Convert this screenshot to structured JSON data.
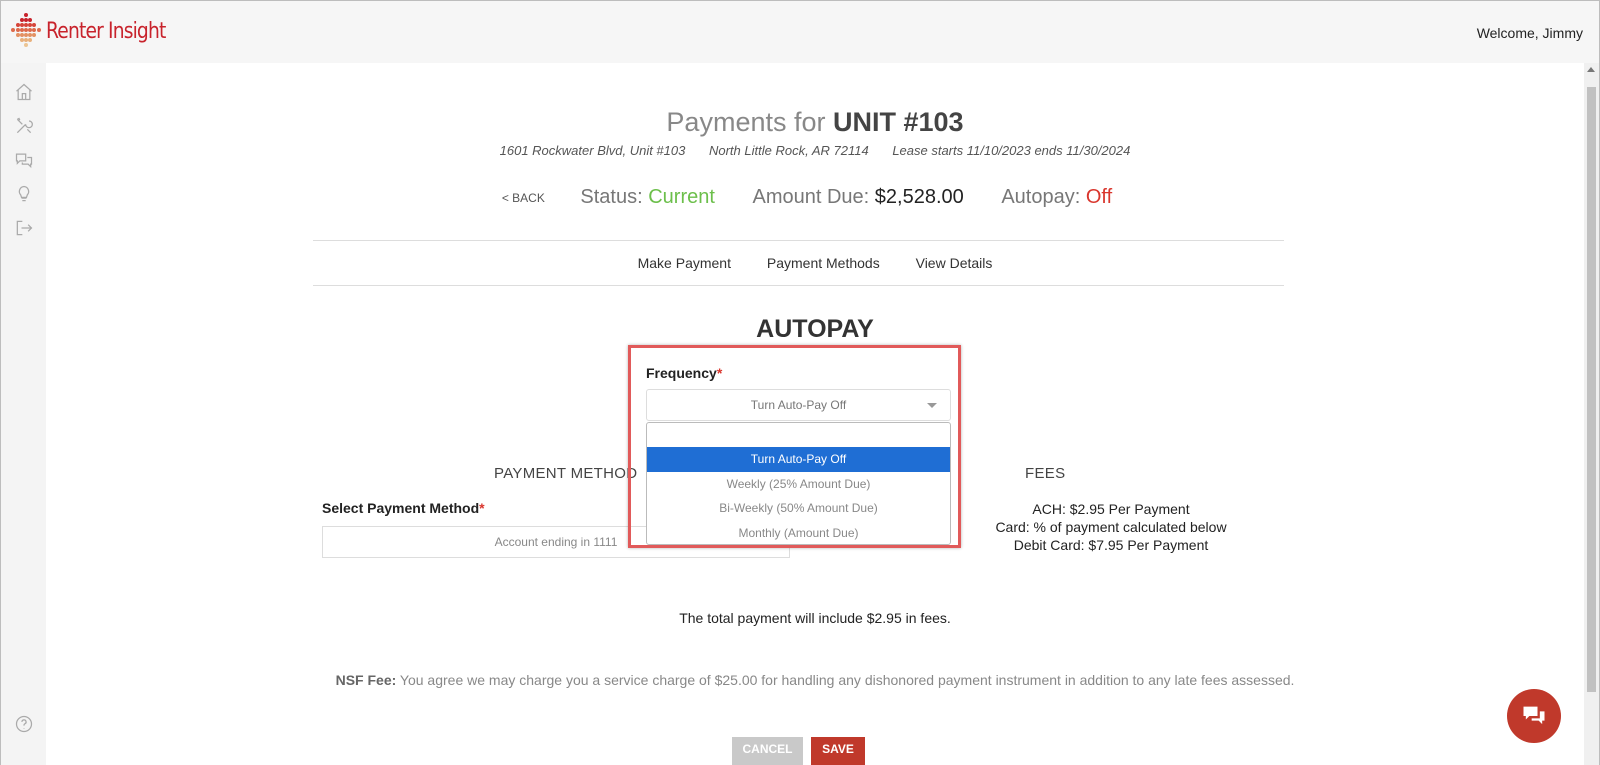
{
  "brand": {
    "name": "Renter Insight",
    "color": "#c8232c"
  },
  "header": {
    "welcome": "Welcome, Jimmy"
  },
  "rail": {
    "icons": [
      "home-icon",
      "tools-icon",
      "chat-bubbles-icon",
      "lightbulb-icon",
      "logout-icon",
      "help-icon"
    ]
  },
  "page": {
    "title_prefix": "Payments for",
    "title_unit": "UNIT #103",
    "address": "1601 Rockwater Blvd, Unit #103",
    "city": "North Little Rock, AR 72114",
    "lease": "Lease starts 11/10/2023 ends 11/30/2024"
  },
  "status": {
    "back_label": "< BACK",
    "status_label": "Status:",
    "status_value": "Current",
    "amount_label": "Amount Due:",
    "amount_value": "$2,528.00",
    "autopay_label": "Autopay:",
    "autopay_value": "Off"
  },
  "tabs": [
    "Make Payment",
    "Payment Methods",
    "View Details"
  ],
  "autopay": {
    "title": "AUTOPAY",
    "frequency_label": "Frequency",
    "frequency_value": "Turn Auto-Pay Off",
    "options": [
      "Turn Auto-Pay Off",
      "Weekly (25% Amount Due)",
      "Bi-Weekly (50% Amount Due)",
      "Monthly (Amount Due)"
    ],
    "selected_index": 0
  },
  "payment_method": {
    "heading": "PAYMENT METHOD",
    "label": "Select Payment Method",
    "value": "Account ending in 1111"
  },
  "fees": {
    "heading": "FEES",
    "lines": [
      "ACH: $2.95 Per Payment",
      "Card: % of payment calculated below",
      "Debit Card: $7.95 Per Payment"
    ]
  },
  "total_note": "The total payment will include $2.95 in fees.",
  "nsf": {
    "label": "NSF Fee:",
    "text": "You agree we may charge you a service charge of $25.00 for handling any dishonored payment instrument in addition to any late fees assessed."
  },
  "buttons": {
    "cancel": "CANCEL",
    "save": "SAVE"
  },
  "colors": {
    "accent_red": "#c0392b",
    "status_green": "#6cbf4b",
    "select_blue": "#1f6ed4"
  }
}
